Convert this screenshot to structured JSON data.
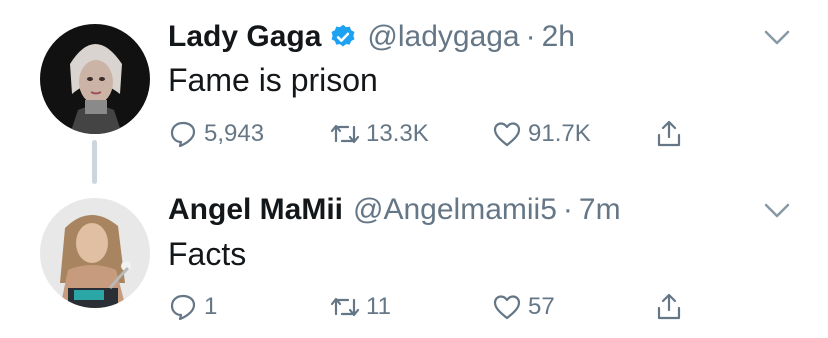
{
  "tweets": [
    {
      "author_name": "Lady Gaga",
      "verified": true,
      "handle": "@ladygaga",
      "separator": "·",
      "time": "2h",
      "text": "Fame is prison",
      "replies": "5,943",
      "retweets": "13.3K",
      "likes": "91.7K"
    },
    {
      "author_name": "Angel MaMii",
      "verified": false,
      "handle": "@Angelmamii5",
      "separator": "·",
      "time": "7m",
      "text": "Facts",
      "replies": "1",
      "retweets": "11",
      "likes": "57"
    }
  ],
  "icons": {
    "verified": "verified-badge-icon",
    "reply": "reply-icon",
    "retweet": "retweet-icon",
    "like": "heart-icon",
    "share": "share-icon",
    "menu": "chevron-down-icon"
  },
  "colors": {
    "text": "#14171a",
    "secondary": "#657786",
    "verified": "#1da1f2",
    "thread_line": "#ccd6dd"
  }
}
